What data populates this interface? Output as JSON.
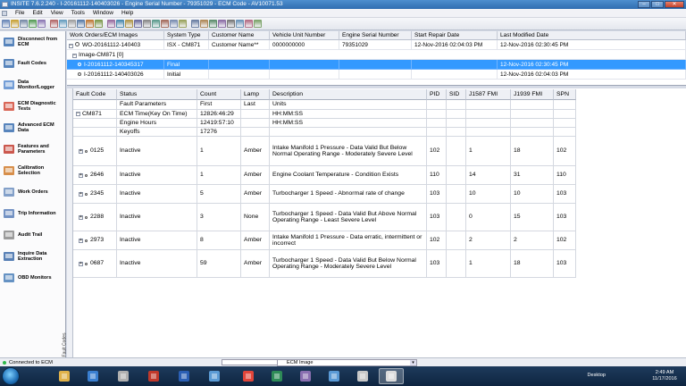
{
  "window": {
    "title": "INSITE 7.6.2.240  -  I-20161112-140403026  -  Engine Serial Number - 79351029 - ECM Code - AV10071.53",
    "controls": {
      "minimize": "–",
      "maximize": "□",
      "close": "✕"
    }
  },
  "menu": [
    "File",
    "Edit",
    "View",
    "Tools",
    "Window",
    "Help"
  ],
  "nav": [
    {
      "label": "Disconnect from ECM",
      "icon": "disconnect-icon"
    },
    {
      "label": "Fault Codes",
      "icon": "fault-codes-icon"
    },
    {
      "label": "Data Monitor/Logger",
      "icon": "data-monitor-icon"
    },
    {
      "label": "ECM Diagnostic Tests",
      "icon": "diagnostic-tests-icon"
    },
    {
      "label": "Advanced ECM Data",
      "icon": "advanced-ecm-icon"
    },
    {
      "label": "Features and Parameters",
      "icon": "features-icon"
    },
    {
      "label": "Calibration Selection",
      "icon": "calibration-icon"
    },
    {
      "label": "Work Orders",
      "icon": "work-orders-icon"
    },
    {
      "label": "Trip Information",
      "icon": "trip-info-icon"
    },
    {
      "label": "Audit Trail",
      "icon": "audit-trail-icon"
    },
    {
      "label": "Inquire Data Extraction",
      "icon": "inquire-icon"
    },
    {
      "label": "OBD Monitors",
      "icon": "obd-icon"
    }
  ],
  "work_orders": {
    "headers": [
      "Work Orders/ECM Images",
      "System Type",
      "Customer Name",
      "Vehicle Unit Number",
      "Engine Serial Number",
      "Start Repair Date",
      "Last Modified Date"
    ],
    "order": {
      "name": "WO-20161112-140403",
      "system": "ISX - CM871",
      "customer": "Customer Name**",
      "unit": "0000000000",
      "esn": "79351029",
      "start": "12-Nov-2016 02:04:03 PM",
      "modified": "12-Nov-2016 02:30:45 PM"
    },
    "group": "Image-CM871 [0]",
    "images": [
      {
        "name": "I-20161112-140345317",
        "type": "Final",
        "modified": "12-Nov-2016 02:30:45 PM",
        "selected": true
      },
      {
        "name": "I-20161112-140403026",
        "type": "Initial",
        "modified": "12-Nov-2016 02:04:03 PM",
        "selected": false
      }
    ]
  },
  "faults": {
    "headers": [
      "Fault Code",
      "Status",
      "Count",
      "Lamp",
      "Description",
      "PID",
      "SID",
      "J1587 FMI",
      "J1939 FMI",
      "SPN"
    ],
    "subheader": {
      "status": "Fault Parameters",
      "count": "First",
      "lamp": "Last",
      "desc": "Units"
    },
    "group": "CM871",
    "params": [
      {
        "name": "ECM Time(Key On Time)",
        "value": "12826:46:29",
        "units": "HH:MM:SS"
      },
      {
        "name": "Engine Hours",
        "value": "12419:57:10",
        "units": "HH:MM:SS"
      },
      {
        "name": "Keyoffs",
        "value": "17276",
        "units": ""
      }
    ],
    "rows": [
      {
        "code": "0125",
        "status": "Inactive",
        "count": "1",
        "lamp": "Amber",
        "desc": "Intake Manifold 1 Pressure - Data Valid But Below Normal Operating Range - Moderately Severe Level",
        "pid": "102",
        "sid": "",
        "j1587": "1",
        "j1939": "18",
        "spn": "102"
      },
      {
        "code": "2646",
        "status": "Inactive",
        "count": "1",
        "lamp": "Amber",
        "desc": "Engine Coolant Temperature - Condition Exists",
        "pid": "110",
        "sid": "",
        "j1587": "14",
        "j1939": "31",
        "spn": "110"
      },
      {
        "code": "2345",
        "status": "Inactive",
        "count": "5",
        "lamp": "Amber",
        "desc": "Turbocharger 1 Speed - Abnormal rate of change",
        "pid": "103",
        "sid": "",
        "j1587": "10",
        "j1939": "10",
        "spn": "103"
      },
      {
        "code": "2288",
        "status": "Inactive",
        "count": "3",
        "lamp": "None",
        "desc": "Turbocharger 1 Speed - Data Valid But Above Normal Operating Range - Least Severe Level",
        "pid": "103",
        "sid": "",
        "j1587": "0",
        "j1939": "15",
        "spn": "103"
      },
      {
        "code": "2973",
        "status": "Inactive",
        "count": "8",
        "lamp": "Amber",
        "desc": "Intake Manifold 1 Pressure - Data erratic, intermittent or incorrect",
        "pid": "102",
        "sid": "",
        "j1587": "2",
        "j1939": "2",
        "spn": "102"
      },
      {
        "code": "0687",
        "status": "Inactive",
        "count": "59",
        "lamp": "Amber",
        "desc": "Turbocharger 1 Speed - Data Valid But Below Normal Operating Range - Moderately Severe Level",
        "pid": "103",
        "sid": "",
        "j1587": "1",
        "j1939": "18",
        "spn": "103"
      }
    ],
    "tab_label": "Fault Codes"
  },
  "status": {
    "connection": "Connected to ECM",
    "image_select": "ECM Image"
  },
  "taskbar": {
    "desktop": "Desktop",
    "time": "2:49 AM",
    "date": "11/17/2016"
  },
  "colors": {
    "selected": "#3399ff",
    "header": "#eef0f5",
    "taskbar": "#1e3b5c"
  }
}
